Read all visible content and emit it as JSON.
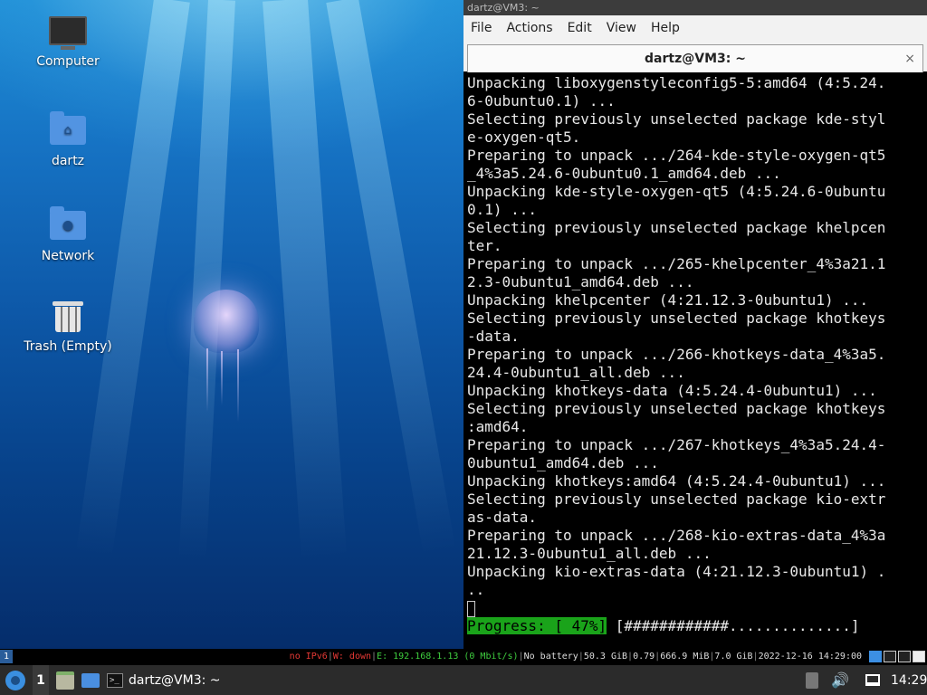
{
  "desktop": {
    "icons": [
      {
        "label": "Computer",
        "icon": "computer-icon"
      },
      {
        "label": "dartz",
        "icon": "home-folder-icon"
      },
      {
        "label": "Network",
        "icon": "network-folder-icon"
      },
      {
        "label": "Trash (Empty)",
        "icon": "trash-icon"
      }
    ]
  },
  "terminal": {
    "window_title": "dartz@VM3: ~",
    "menu": [
      "File",
      "Actions",
      "Edit",
      "View",
      "Help"
    ],
    "tab_title": "dartz@VM3: ~",
    "close_glyph": "×",
    "lines": [
      "Unpacking liboxygenstyleconfig5-5:amd64 (4:5.24.",
      "6-0ubuntu0.1) ...",
      "Selecting previously unselected package kde-styl",
      "e-oxygen-qt5.",
      "Preparing to unpack .../264-kde-style-oxygen-qt5",
      "_4%3a5.24.6-0ubuntu0.1_amd64.deb ...",
      "Unpacking kde-style-oxygen-qt5 (4:5.24.6-0ubuntu",
      "0.1) ...",
      "Selecting previously unselected package khelpcen",
      "ter.",
      "Preparing to unpack .../265-khelpcenter_4%3a21.1",
      "2.3-0ubuntu1_amd64.deb ...",
      "Unpacking khelpcenter (4:21.12.3-0ubuntu1) ...",
      "Selecting previously unselected package khotkeys",
      "-data.",
      "Preparing to unpack .../266-khotkeys-data_4%3a5.",
      "24.4-0ubuntu1_all.deb ...",
      "Unpacking khotkeys-data (4:5.24.4-0ubuntu1) ...",
      "Selecting previously unselected package khotkeys",
      ":amd64.",
      "Preparing to unpack .../267-khotkeys_4%3a5.24.4-",
      "0ubuntu1_amd64.deb ...",
      "Unpacking khotkeys:amd64 (4:5.24.4-0ubuntu1) ...",
      "Selecting previously unselected package kio-extr",
      "as-data.",
      "Preparing to unpack .../268-kio-extras-data_4%3a",
      "21.12.3-0ubuntu1_all.deb ...",
      "Unpacking kio-extras-data (4:21.12.3-0ubuntu1) .",
      ".."
    ],
    "progress_label": "Progress: [ 47%]",
    "progress_bar": " [############..............]",
    "progress_value": 47
  },
  "statusbar": {
    "workspace": "1",
    "ipv6": "no IPv6",
    "wifi": "W: down",
    "ethernet": "E: 192.168.1.13 (0 Mbit/s)",
    "battery": "No battery",
    "disk": "50.3 GiB",
    "load": "0.79",
    "memory": "666.9 MiB",
    "memory_total": "7.0 GiB",
    "datetime": "2022-12-16 14:29:00",
    "colors": {
      "ipv6": "#e53935",
      "wifi": "#e53935",
      "ethernet": "#3fce3f"
    }
  },
  "taskbar": {
    "workspace": "1",
    "task_title": "dartz@VM3: ~",
    "clock": "14:29",
    "icons": [
      "start-menu-icon",
      "file-manager-icon",
      "show-desktop-icon",
      "terminal-icon",
      "system-tray-icon",
      "volume-icon",
      "network-icon"
    ]
  }
}
